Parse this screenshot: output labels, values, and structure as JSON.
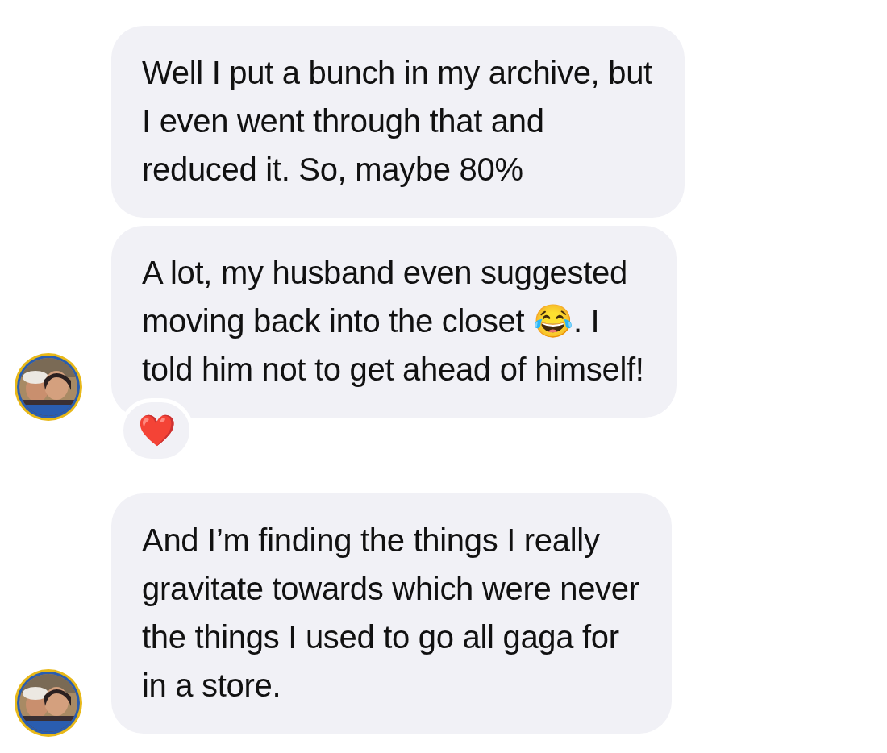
{
  "messages": [
    {
      "text": "Well I put a bunch in my archive, but\nI even went through that and\nreduced it. So, maybe 80%",
      "show_avatar": false
    },
    {
      "text": "A lot, my husband even suggested\nmoving back into the closet 😂. I\ntold him not to get ahead of himself!",
      "show_avatar": true,
      "reaction": "❤️"
    },
    {
      "text": "And I’m finding the things I really\ngravitate towards which were never\nthe things I used to go all gaga for\nin a store.",
      "show_avatar": true
    }
  ]
}
